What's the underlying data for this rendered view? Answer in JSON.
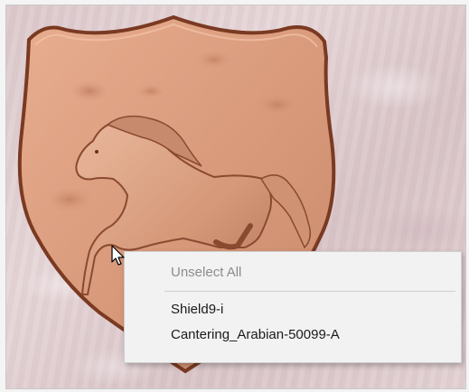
{
  "context_menu": {
    "items": [
      {
        "label": "Unselect All",
        "enabled": false
      },
      {
        "label": "Shield9-i",
        "enabled": true
      },
      {
        "label": "Cantering_Arabian-50099-A",
        "enabled": true
      }
    ]
  },
  "colors": {
    "background_material": "#dfcdd0",
    "shield_wood": "#d89a7c",
    "shield_edge": "#7a3a22",
    "menu_background": "#f2f2f2",
    "menu_disabled_text": "#8c8c8c"
  },
  "icons": {
    "cursor": "arrow-pointer-icon"
  }
}
